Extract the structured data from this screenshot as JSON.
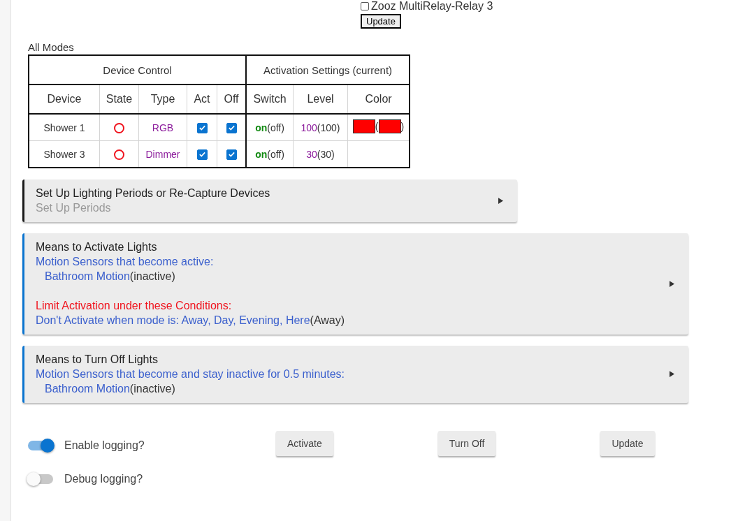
{
  "top_device": {
    "label": "Zooz MultiRelay-Relay 3",
    "checked": false
  },
  "top_button": "Update",
  "table": {
    "title": "All Modes",
    "groups": [
      "Device Control",
      "Activation Settings (current)"
    ],
    "columns": [
      "Device",
      "State",
      "Type",
      "Act",
      "Off",
      "Switch",
      "Level",
      "Color"
    ],
    "rows": [
      {
        "device": "Shower 1",
        "on": false,
        "type": "RGB",
        "act": true,
        "off": true,
        "switch": "on",
        "switch_current": "(off)",
        "level": "100",
        "level_current": "(100)",
        "color": "#ff0000",
        "paren_open": "(",
        "current_swatch": {
          "color": "#ff0000"
        },
        "paren_close": ")"
      },
      {
        "device": "Shower 3",
        "on": false,
        "type": "Dimmer",
        "act": true,
        "off": true,
        "switch": "on",
        "switch_current": "(off)",
        "level": "30",
        "level_current": "(30)"
      }
    ]
  },
  "sections": [
    {
      "title": "Set Up Lighting Periods or Re-Capture Devices",
      "color": "#1a1a1a",
      "wide": false,
      "groups": [
        {
          "lines": [
            {
              "kind": "subtitle",
              "text": "Set Up Periods"
            }
          ]
        }
      ]
    },
    {
      "title": "Means to Activate Lights",
      "color": "#0a74d0",
      "wide": true,
      "groups": [
        {
          "lines": [
            {
              "kind": "heading",
              "text": "Motion Sensors that become active:"
            },
            {
              "kind": "device",
              "text": "Bathroom Motion",
              "suffix": "(inactive)"
            }
          ]
        },
        {
          "lines": [
            {
              "kind": "warning",
              "text": "Limit Activation under these Conditions:"
            },
            {
              "kind": "setting",
              "text": "Don't Activate when mode is: Away, Day, Evening, Here",
              "suffix": "(Away)"
            }
          ]
        }
      ]
    },
    {
      "title": "Means to Turn Off Lights",
      "color": "#0a74d0",
      "wide": true,
      "groups": [
        {
          "lines": [
            {
              "kind": "heading",
              "text": "Motion Sensors that become and stay inactive for 0.5 minutes:"
            },
            {
              "kind": "device",
              "text": "Bathroom Motion",
              "suffix": "(inactive)"
            }
          ]
        }
      ]
    }
  ],
  "toggles": [
    {
      "label": "Enable logging?",
      "on": true
    },
    {
      "label": "Debug logging?",
      "on": false
    }
  ],
  "buttons": [
    "Activate",
    "Turn Off",
    "Update"
  ]
}
